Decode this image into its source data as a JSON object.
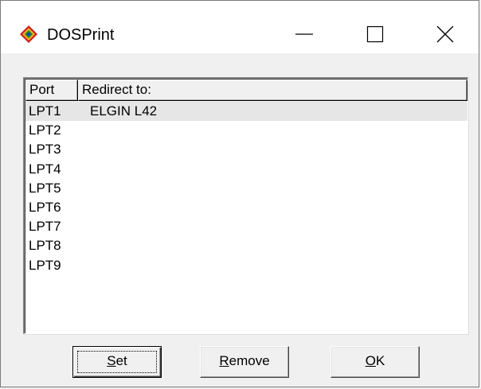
{
  "window": {
    "title": "DOSPrint",
    "icon": "dosprint-app-icon",
    "controls": [
      "minimize-icon",
      "maximize-icon",
      "close-icon"
    ]
  },
  "list": {
    "columns": {
      "port": "Port",
      "redirect": "Redirect to:"
    },
    "rows": [
      {
        "port": "LPT1",
        "redirect": "ELGIN L42"
      },
      {
        "port": "LPT2",
        "redirect": ""
      },
      {
        "port": "LPT3",
        "redirect": ""
      },
      {
        "port": "LPT4",
        "redirect": ""
      },
      {
        "port": "LPT5",
        "redirect": ""
      },
      {
        "port": "LPT6",
        "redirect": ""
      },
      {
        "port": "LPT7",
        "redirect": ""
      },
      {
        "port": "LPT8",
        "redirect": ""
      },
      {
        "port": "LPT9",
        "redirect": ""
      }
    ],
    "selected_row": "LPT1"
  },
  "buttons": {
    "set": {
      "mnemonic": "S",
      "rest": "et"
    },
    "remove": {
      "mnemonic": "R",
      "rest": "emove"
    },
    "ok": {
      "mnemonic": "O",
      "rest": "K"
    }
  }
}
